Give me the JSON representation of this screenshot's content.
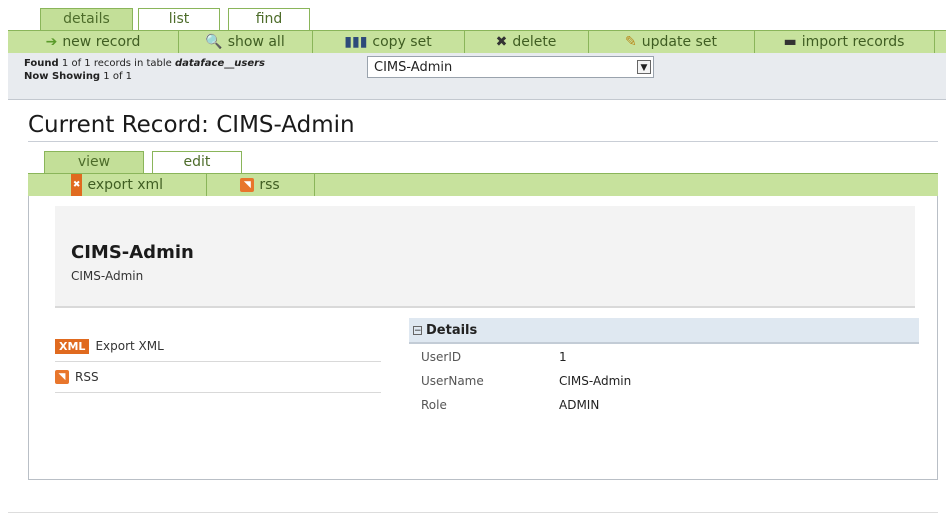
{
  "top_tabs": {
    "details": "details",
    "list": "list",
    "find": "find"
  },
  "actions": {
    "new_record": "new record",
    "show_all": "show all",
    "copy_set": "copy set",
    "delete": "delete",
    "update_set": "update set",
    "import_records": "import records"
  },
  "status": {
    "found": "Found",
    "count_a": "1",
    "of": "of",
    "count_b": "1",
    "records_in_table": "records in table",
    "table_name": "dataface__users",
    "now_showing": "Now Showing",
    "showing_range": "1 of 1"
  },
  "record_select": {
    "value": "CIMS-Admin"
  },
  "page": {
    "title": "Current Record: CIMS-Admin"
  },
  "sub_tabs": {
    "view": "view",
    "edit": "edit"
  },
  "sub_actions": {
    "export_xml": "export xml",
    "rss": "rss"
  },
  "record": {
    "name": "CIMS-Admin",
    "subtitle": "CIMS-Admin"
  },
  "links": {
    "xml_badge": "XML",
    "export_xml": "Export XML",
    "rss_badge": "◥",
    "rss": "RSS"
  },
  "details": {
    "heading": "Details",
    "rows": [
      {
        "label": "UserID",
        "value": "1"
      },
      {
        "label": "UserName",
        "value": "CIMS-Admin"
      },
      {
        "label": "Role",
        "value": "ADMIN"
      }
    ]
  },
  "colors": {
    "tab_green": "#c7e29d",
    "border_green": "#8ab55a",
    "status_bg": "#e8ebef",
    "xml_orange": "#e06a1f"
  },
  "icons": {
    "new_record": "arrow-icon",
    "show_all": "magnifier-icon",
    "copy_set": "chart-icon",
    "delete": "delete-icon",
    "update_set": "pencil-icon",
    "import_records": "printer-icon"
  }
}
